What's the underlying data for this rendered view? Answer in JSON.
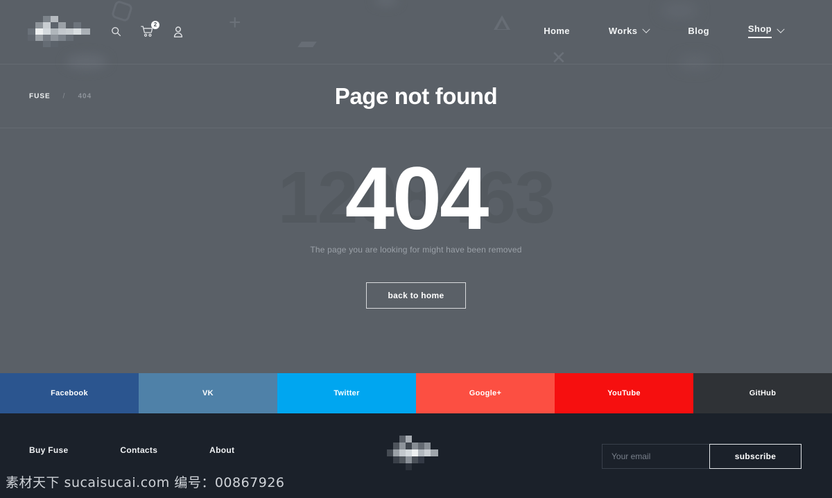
{
  "header": {
    "logo_alt": "fuse-logo",
    "icons": [
      {
        "name": "search-icon",
        "label": "Search"
      },
      {
        "name": "cart-icon",
        "label": "Cart",
        "badge": "2"
      },
      {
        "name": "user-icon",
        "label": "Account"
      }
    ],
    "nav": [
      {
        "label": "Home",
        "has_chevron": false,
        "active": false
      },
      {
        "label": "Works",
        "has_chevron": true,
        "active": false
      },
      {
        "label": "Blog",
        "has_chevron": false,
        "active": false
      },
      {
        "label": "Shop",
        "has_chevron": true,
        "active": true
      }
    ]
  },
  "breadcrumb": {
    "root": "FUSE",
    "separator": "/",
    "current": "404"
  },
  "page_title": "Page not found",
  "error": {
    "ghost_number": "1208463",
    "code": "404",
    "message": "The page you are looking for might have been removed",
    "button_label": "back to home"
  },
  "social": [
    {
      "label": "Facebook",
      "color": "#2b558f"
    },
    {
      "label": "VK",
      "color": "#4f81a8"
    },
    {
      "label": "Twitter",
      "color": "#00a6f0"
    },
    {
      "label": "Google+",
      "color": "#fc4f42"
    },
    {
      "label": "YouTube",
      "color": "#f60f0f"
    },
    {
      "label": "GitHub",
      "color": "#2f3236"
    }
  ],
  "footer": {
    "links": [
      "Buy Fuse",
      "Contacts",
      "About"
    ],
    "logo_alt": "fuse-footer-logo",
    "subscribe": {
      "placeholder": "Your email",
      "value": "",
      "button_label": "subscribe"
    }
  },
  "watermark": "素材天下 sucaisucai.com  编号：00867926",
  "colors": {
    "hero_bg": "#5a6067",
    "footer_bg": "#1b212a",
    "text_light": "#ffffff",
    "text_muted": "#9ba1a8"
  }
}
